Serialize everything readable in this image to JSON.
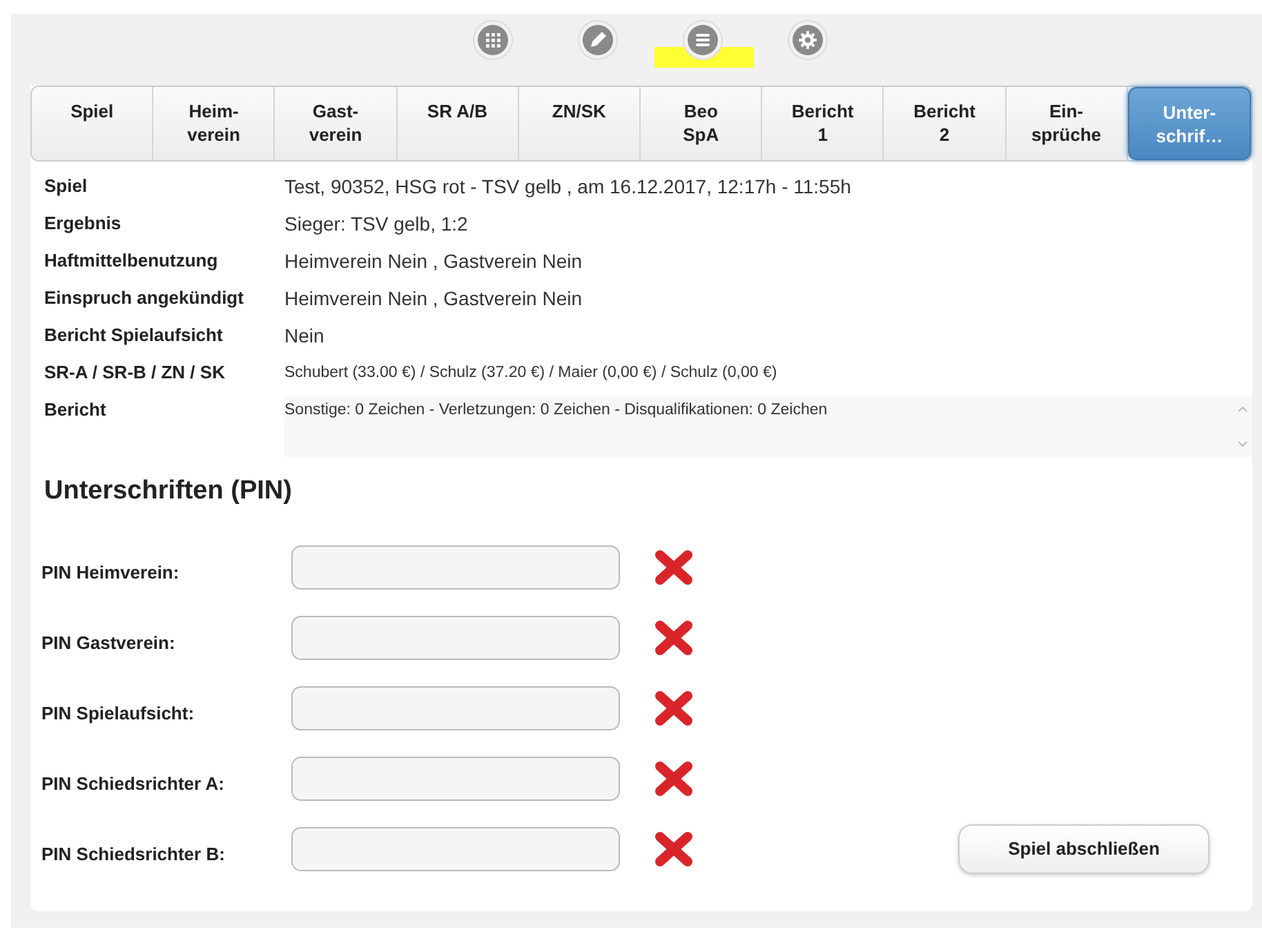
{
  "toolbar": [
    {
      "kind": "grid",
      "selected": false
    },
    {
      "kind": "pencil",
      "selected": false
    },
    {
      "kind": "list",
      "selected": true
    },
    {
      "kind": "gear",
      "selected": false
    }
  ],
  "tabs": [
    {
      "label": "Spiel",
      "selected": false
    },
    {
      "label": "Heim-\nverein",
      "selected": false
    },
    {
      "label": "Gast-\nverein",
      "selected": false
    },
    {
      "label": "SR A/B",
      "selected": false
    },
    {
      "label": "ZN/SK",
      "selected": false
    },
    {
      "label": "Beo\nSpA",
      "selected": false
    },
    {
      "label": "Bericht\n1",
      "selected": false
    },
    {
      "label": "Bericht\n2",
      "selected": false
    },
    {
      "label": "Ein-\nsprüche",
      "selected": false
    },
    {
      "label": "Unter-\nschrif…",
      "selected": true
    }
  ],
  "summary": [
    {
      "label": "Spiel",
      "value": "Test, 90352, HSG rot - TSV gelb , am 16.12.2017, 12:17h - 11:55h",
      "kind": "text"
    },
    {
      "label": "Ergebnis",
      "value": "Sieger: TSV gelb, 1:2",
      "kind": "text"
    },
    {
      "label": "Haftmittelbenutzung",
      "value": "Heimverein Nein , Gastverein Nein",
      "kind": "text"
    },
    {
      "label": "Einspruch angekündigt",
      "value": "Heimverein Nein , Gastverein Nein",
      "kind": "text"
    },
    {
      "label": "Bericht Spielaufsicht",
      "value": "Nein",
      "kind": "text"
    },
    {
      "label": "SR-A / SR-B / ZN / SK",
      "value": "Schubert (33.00 €) / Schulz (37.20 €) / Maier (0,00 €) / Schulz (0,00 €)",
      "kind": "small"
    },
    {
      "label": "Bericht",
      "value": "Sonstige: 0 Zeichen - Verletzungen: 0 Zeichen - Disqualifikationen: 0 Zeichen",
      "kind": "box"
    }
  ],
  "signatures": {
    "heading": "Unterschriften (PIN)",
    "fields": [
      {
        "label": "PIN Heimverein:",
        "valid": false
      },
      {
        "label": "PIN Gastverein:",
        "valid": false
      },
      {
        "label": "PIN Spielaufsicht:",
        "valid": false
      },
      {
        "label": "PIN Schiedsrichter A:",
        "valid": false
      },
      {
        "label": "PIN Schiedsrichter B:",
        "valid": false
      }
    ],
    "button": "Spiel abschließen"
  }
}
